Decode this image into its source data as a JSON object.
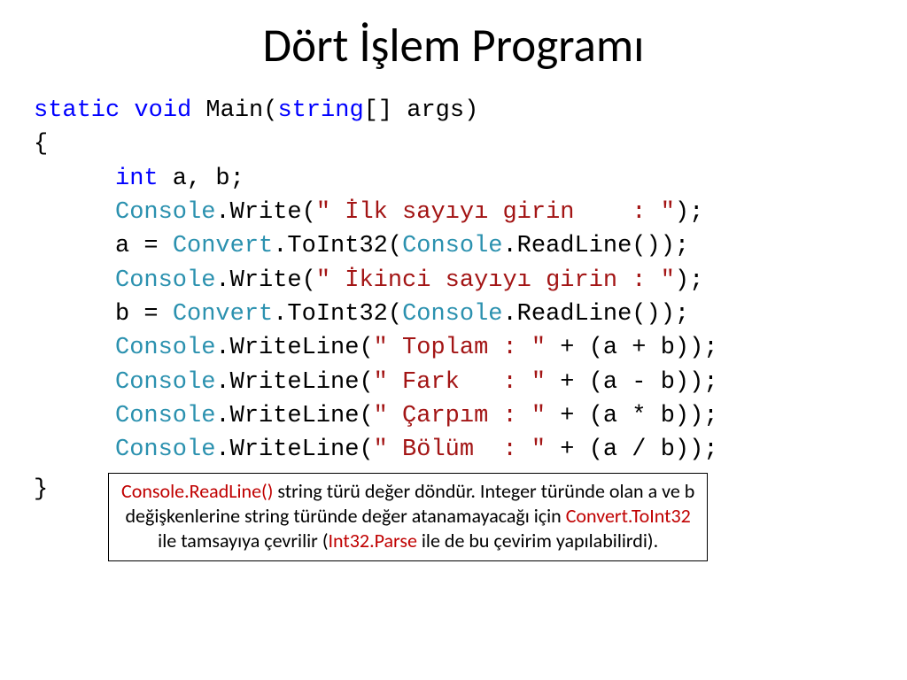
{
  "title": "Dört İşlem Programı",
  "code": {
    "l1": {
      "kw1": "static",
      "kw2": "void",
      "fn": " Main(",
      "type": "string",
      "rest": "[] args)"
    },
    "l2": "{",
    "l3": {
      "kw": "int",
      "rest": " a, b;"
    },
    "l4": {
      "cls": "Console",
      "m": ".Write(",
      "str": " İlk sayıyı girin    : ",
      "end": ");"
    },
    "l5": {
      "p1": "a = ",
      "cls1": "Convert",
      "m1": ".ToInt32(",
      "cls2": "Console",
      "m2": ".ReadLine());"
    },
    "l6": {
      "cls": "Console",
      "m": ".Write(",
      "str": " İkinci sayıyı girin : ",
      "end": ");"
    },
    "l7": {
      "p1": "b = ",
      "cls1": "Convert",
      "m1": ".ToInt32(",
      "cls2": "Console",
      "m2": ".ReadLine());"
    },
    "l8": {
      "cls": "Console",
      "m": ".WriteLine(",
      "str": " Toplam : ",
      "end": " + (a + b));"
    },
    "l9": {
      "cls": "Console",
      "m": ".WriteLine(",
      "str": " Fark   : ",
      "end": " + (a - b));"
    },
    "l10": {
      "cls": "Console",
      "m": ".WriteLine(",
      "str": " Çarpım : ",
      "end": " + (a * b));"
    },
    "l11": {
      "cls": "Console",
      "m": ".WriteLine(",
      "str": " Bölüm  : ",
      "end": " + (a / b));"
    },
    "l12": "}"
  },
  "q": "\"",
  "note": {
    "r1a": "Console.ReadLine()",
    "r1b": " string türü değer döndür. Integer türünde olan a ve b",
    "r2a": "değişkenlerine string türünde değer atanamayacağı için ",
    "r2b": "Convert.ToInt32",
    "r3a": "ile tamsayıya çevrilir (",
    "r3b": "Int32.Parse",
    "r3c": " ile de bu çevirim yapılabilirdi)."
  }
}
